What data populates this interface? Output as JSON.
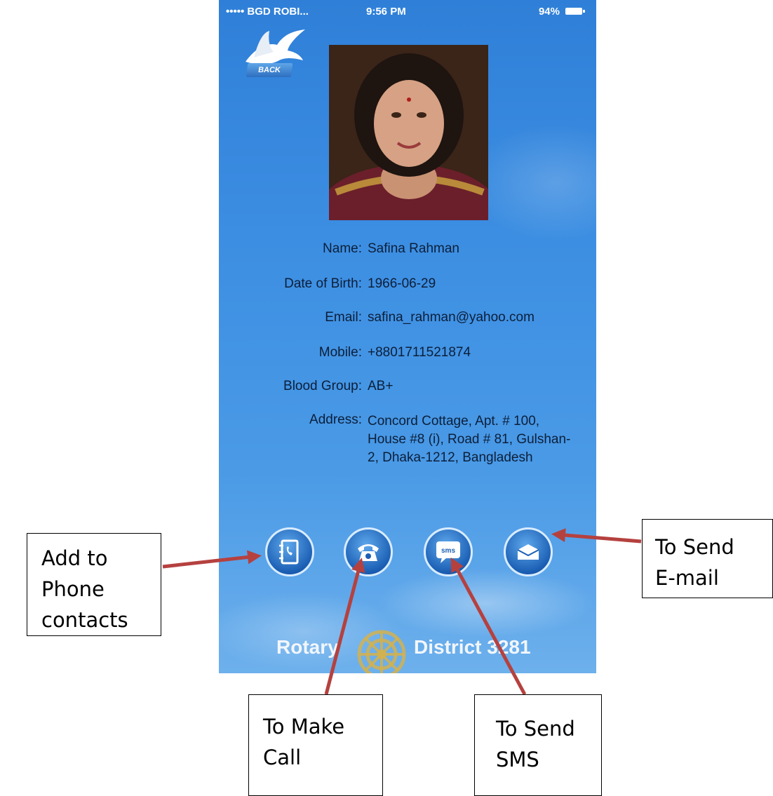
{
  "status_bar": {
    "carrier": "••••• BGD ROBI...",
    "time": "9:56 PM",
    "battery": "94%"
  },
  "back_button": {
    "label": "BACK"
  },
  "profile": {
    "fields": [
      {
        "label": "Name:",
        "value": "Safina Rahman"
      },
      {
        "label": "Date of Birth:",
        "value": "1966-06-29"
      },
      {
        "label": "Email:",
        "value": "safina_rahman@yahoo.com"
      },
      {
        "label": "Mobile:",
        "value": "+8801711521874"
      },
      {
        "label": "Blood Group:",
        "value": "AB+"
      },
      {
        "label": "Address:",
        "value": "Concord Cottage, Apt. # 100, House #8 (i), Road # 81, Gulshan-2, Dhaka-1212, Bangladesh"
      }
    ]
  },
  "actions": {
    "contacts_icon": "address-book-icon",
    "call_icon": "phone-icon",
    "sms_icon": "sms-icon",
    "sms_text": "sms",
    "email_icon": "envelope-icon"
  },
  "footer": {
    "left": "Rotary",
    "right": "District 3281"
  },
  "callouts": {
    "contacts_line1": "Add to",
    "contacts_line2": "Phone",
    "contacts_line3": "contacts",
    "call_line1": "To Make",
    "call_line2": "Call",
    "sms_line1": "To Send",
    "sms_line2": "SMS",
    "email_line1": "To Send",
    "email_line2": "E-mail"
  },
  "colors": {
    "sky_top": "#2f7fd8",
    "sky_bottom": "#6db0ec",
    "arrow": "#b5413f",
    "rotary_gold": "#d7b24a"
  }
}
